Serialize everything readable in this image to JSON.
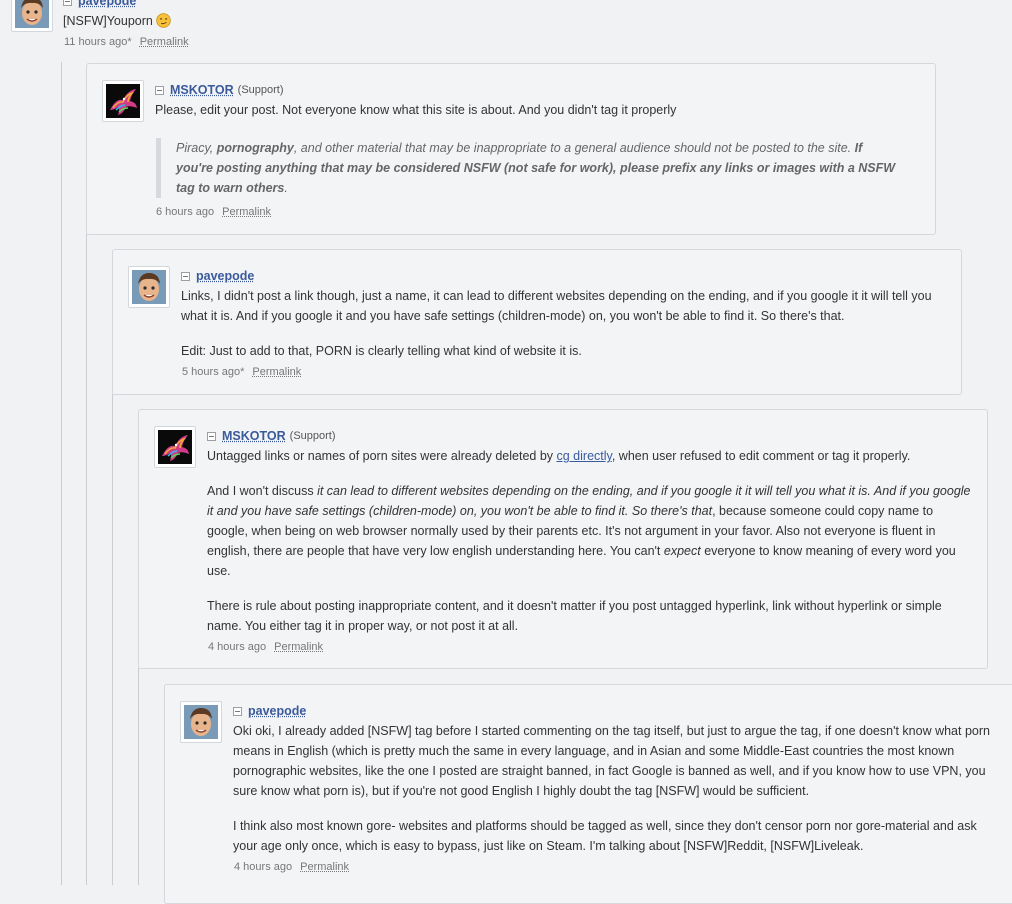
{
  "comments": {
    "c0": {
      "username": "pavepode",
      "text": "[NSFW]Youporn",
      "emoji": "smirk-emoji",
      "time": "11 hours ago*",
      "permalink": "Permalink"
    },
    "c1": {
      "username": "MSKOTOR",
      "role": "(Support)",
      "text": "Please, edit your post. Not everyone know what this site is about. And you didn't tag it properly",
      "quote": {
        "part1": "Piracy, ",
        "part2": "pornography",
        "part3": ", and other material that may be inappropriate to a general audience should not be posted to the site. ",
        "part4": "If you're posting anything that may be considered NSFW (not safe for work), please prefix any links or images with a NSFW tag to warn others",
        "part5": "."
      },
      "time": "6 hours ago",
      "permalink": "Permalink"
    },
    "c2": {
      "username": "pavepode",
      "p1": "Links, I didn't post a link though, just a name, it can lead to different websites depending on the ending, and if you google it it will tell you what it is. And if you google it and you have safe settings (children-mode) on, you won't be able to find it. So there's that.",
      "p2": "Edit: Just to add to that, PORN is clearly telling what kind of website it is.",
      "time": "5 hours ago*",
      "permalink": "Permalink"
    },
    "c3": {
      "username": "MSKOTOR",
      "role": "(Support)",
      "p1a": "Untagged links or names of porn sites were already deleted by ",
      "p1link": "cg directly",
      "p1b": ", when user refused to edit comment or tag it properly.",
      "p2a": "And I won't discuss ",
      "p2i": "it can lead to different websites depending on the ending, and if you google it it will tell you what it is. And if you google it and you have safe settings (children-mode) on, you won't be able to find it. So there's that",
      "p2b": ", because someone could copy name to google, when being on web browser normally used by their parents etc. It's not argument in your favor. Also not everyone is fluent in english, there are people that have very low english understanding here. You can't ",
      "p2i2": "expect",
      "p2c": " everyone to know meaning of every word you use.",
      "p3": "There is rule about posting inappropriate content, and it doesn't matter if you post untagged hyperlink, link without hyperlink or simple name. You either tag it in proper way, or not post it at all.",
      "time": "4 hours ago",
      "permalink": "Permalink"
    },
    "c4": {
      "username": "pavepode",
      "p1": "Oki oki, I already added [NSFW] tag before I started commenting on the tag itself, but just to argue the tag, if one doesn't know what porn means in English (which is pretty much the same in every language, and in Asian and some Middle-East countries the most known pornographic websites, like the one I posted are straight banned, in fact Google is banned as well, and if you know how to use VPN, you sure know what porn is), but if you're not good English I highly doubt the tag [NSFW] would be sufficient.",
      "p2": "I think also most known gore- websites and platforms should be tagged as well, since they don't censor porn nor gore-material and ask your age only once, which is easy to bypass, just like on Steam. I'm talking about [NSFW]Reddit, [NSFW]Liveleak.",
      "time": "4 hours ago",
      "permalink": "Permalink"
    }
  },
  "colors": {
    "username": "#3a5a9c",
    "background": "#f0f2f4",
    "box_border": "#d4d8dc",
    "thread_line": "#c9cdd2"
  }
}
